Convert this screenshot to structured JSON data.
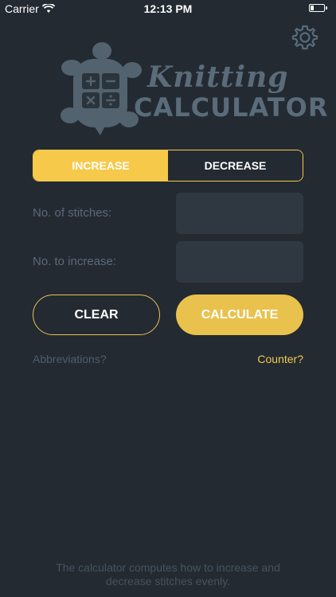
{
  "status_bar": {
    "carrier": "Carrier",
    "time": "12:13 PM"
  },
  "logo": {
    "title": "Knitting",
    "subtitle": "CALCULATOR"
  },
  "mode_toggle": {
    "increase_label": "INCREASE",
    "decrease_label": "DECREASE",
    "selected": "INCREASE"
  },
  "form": {
    "stitches_label": "No. of stitches:",
    "stitches_value": "",
    "increase_label": "No. to increase:",
    "increase_value": ""
  },
  "actions": {
    "clear_label": "CLEAR",
    "calculate_label": "CALCULATE"
  },
  "links": {
    "abbreviations": "Abbreviations?",
    "counter": "Counter?"
  },
  "footer": {
    "line1": "The calculator computes how to increase and",
    "line2": "decrease stitches evenly."
  },
  "colors": {
    "background": "#232a32",
    "accent": "#f6c94a",
    "input_bg": "#2f3841",
    "muted_text": "#5b6a78"
  }
}
